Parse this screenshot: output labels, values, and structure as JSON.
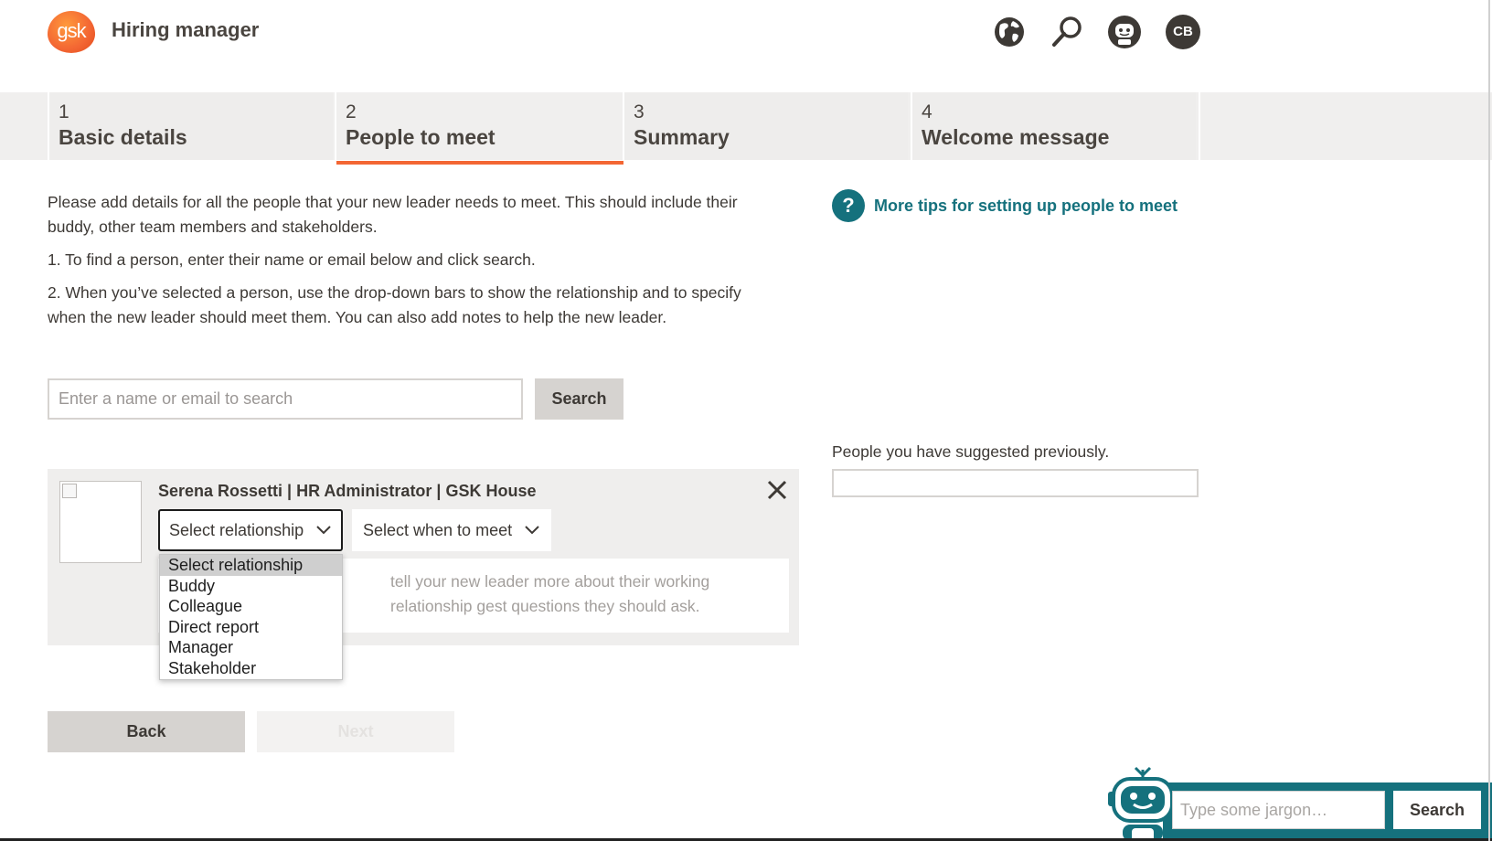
{
  "header": {
    "logo_text": "gsk",
    "title": "Hiring manager",
    "icons": [
      "globe-icon",
      "search-icon",
      "robot-icon"
    ],
    "avatar_initials": "CB"
  },
  "steps": [
    {
      "number": "1",
      "label": "Basic details",
      "active": false
    },
    {
      "number": "2",
      "label": "People to meet",
      "active": true
    },
    {
      "number": "3",
      "label": "Summary",
      "active": false
    },
    {
      "number": "4",
      "label": "Welcome message",
      "active": false
    }
  ],
  "intro": {
    "p1": "Please add details for all the people that your new leader needs to meet. This should include their buddy, other team members and stakeholders.",
    "p2": "1. To find a person, enter their name or email below and click search.",
    "p3": "2. When you’ve selected a person, use the drop-down bars to show the relationship and to specify when the new leader should meet them. You can also add notes to help the new leader."
  },
  "tips": {
    "icon_text": "?",
    "label": "More tips for setting up people to meet"
  },
  "search": {
    "placeholder": "Enter a name or email to search",
    "value": "",
    "button_label": "Search"
  },
  "previous": {
    "label": "People you have suggested previously."
  },
  "person_card": {
    "title": "Serena Rossetti | HR Administrator | GSK House",
    "relationship_select": "Select relationship",
    "when_select": "Select when to meet",
    "notes_visible": "tell your new leader more about their working relationship gest questions they should ask."
  },
  "relationship_options": [
    "Select relationship",
    "Buddy",
    "Colleague",
    "Direct report",
    "Manager",
    "Stakeholder"
  ],
  "footer_buttons": {
    "back": "Back",
    "next": "Next"
  },
  "jargon": {
    "placeholder": "Type some jargon…",
    "button_label": "Search"
  },
  "colors": {
    "accent": "#f36633",
    "teal": "#15717d",
    "step_bg": "#efeeed",
    "button_grey": "#d6d3d0",
    "text": "#3d3935"
  }
}
